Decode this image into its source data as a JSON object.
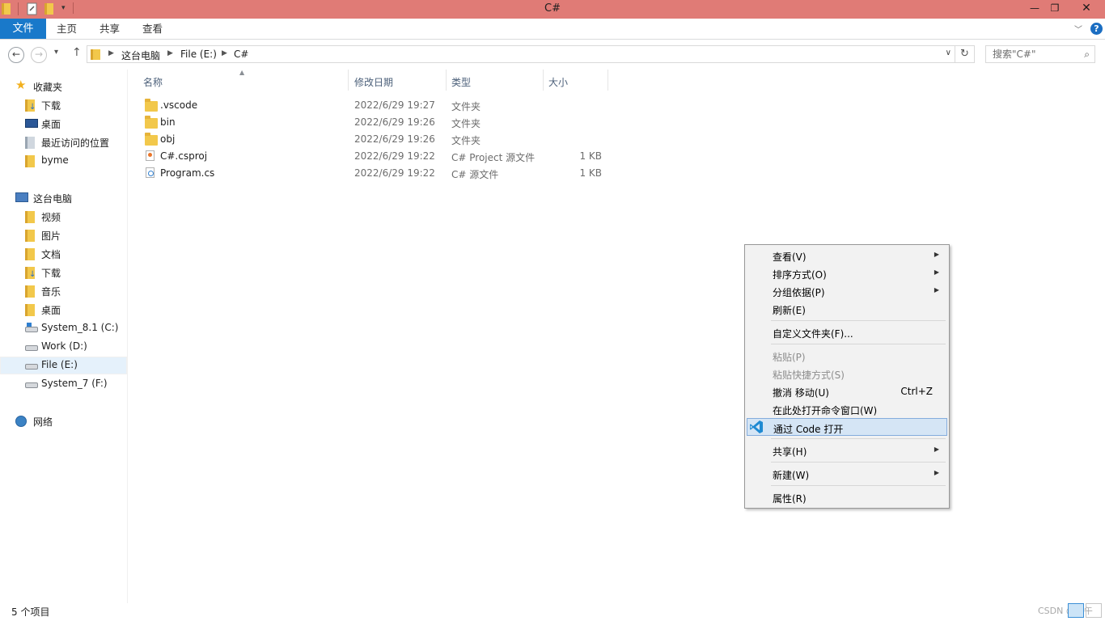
{
  "window": {
    "title": "C#"
  },
  "ribbon": {
    "tabs": [
      {
        "label": "文件"
      },
      {
        "label": "主页"
      },
      {
        "label": "共享"
      },
      {
        "label": "查看"
      }
    ]
  },
  "address": {
    "breadcrumbs": [
      "这台电脑",
      "File (E:)",
      "C#"
    ]
  },
  "search": {
    "placeholder": "搜索\"C#\""
  },
  "nav": {
    "favorites": {
      "label": "收藏夹",
      "items": [
        {
          "label": "下载",
          "icon": "download-folder-icon"
        },
        {
          "label": "桌面",
          "icon": "desktop-icon"
        },
        {
          "label": "最近访问的位置",
          "icon": "recent-places-icon"
        },
        {
          "label": "byme",
          "icon": "folder-icon"
        }
      ]
    },
    "this_pc": {
      "label": "这台电脑",
      "items": [
        {
          "label": "视频",
          "icon": "videos-folder-icon"
        },
        {
          "label": "图片",
          "icon": "pictures-folder-icon"
        },
        {
          "label": "文档",
          "icon": "documents-folder-icon"
        },
        {
          "label": "下载",
          "icon": "download-folder-icon"
        },
        {
          "label": "音乐",
          "icon": "music-folder-icon"
        },
        {
          "label": "桌面",
          "icon": "desktop-folder-icon"
        },
        {
          "label": "System_8.1 (C:)",
          "icon": "system-drive-icon"
        },
        {
          "label": "Work (D:)",
          "icon": "drive-icon"
        },
        {
          "label": "File (E:)",
          "icon": "drive-icon",
          "selected": true
        },
        {
          "label": "System_7 (F:)",
          "icon": "drive-icon"
        }
      ]
    },
    "network": {
      "label": "网络"
    }
  },
  "columns": [
    "名称",
    "修改日期",
    "类型",
    "大小"
  ],
  "files": [
    {
      "name": ".vscode",
      "date": "2022/6/29 19:27",
      "type": "文件夹",
      "size": "",
      "icon": "folder-icon"
    },
    {
      "name": "bin",
      "date": "2022/6/29 19:26",
      "type": "文件夹",
      "size": "",
      "icon": "folder-icon"
    },
    {
      "name": "obj",
      "date": "2022/6/29 19:26",
      "type": "文件夹",
      "size": "",
      "icon": "folder-icon"
    },
    {
      "name": "C#.csproj",
      "date": "2022/6/29 19:22",
      "type": "C# Project 源文件",
      "size": "1 KB",
      "icon": "csproj-file-icon"
    },
    {
      "name": "Program.cs",
      "date": "2022/6/29 19:22",
      "type": "C# 源文件",
      "size": "1 KB",
      "icon": "cs-file-icon"
    }
  ],
  "context_menu": {
    "items": [
      {
        "label": "查看(V)",
        "submenu": true
      },
      {
        "label": "排序方式(O)",
        "submenu": true
      },
      {
        "label": "分组依据(P)",
        "submenu": true
      },
      {
        "label": "刷新(E)"
      },
      {
        "label": "自定义文件夹(F)..."
      },
      {
        "label": "粘贴(P)",
        "disabled": true
      },
      {
        "label": "粘贴快捷方式(S)",
        "disabled": true
      },
      {
        "label": "撤消 移动(U)",
        "shortcut": "Ctrl+Z"
      },
      {
        "label": "在此处打开命令窗口(W)"
      },
      {
        "label": "通过 Code 打开",
        "highlighted": true,
        "icon": "vscode-icon"
      },
      {
        "label": "共享(H)",
        "submenu": true
      },
      {
        "label": "新建(W)",
        "submenu": true
      },
      {
        "label": "属性(R)"
      }
    ]
  },
  "status": {
    "item_count": "5 个项目"
  },
  "watermark": "CSDN @端午",
  "colors": {
    "titlebar": "#e07b76",
    "accent": "#1979ca",
    "highlight": "#d5e5f5"
  }
}
